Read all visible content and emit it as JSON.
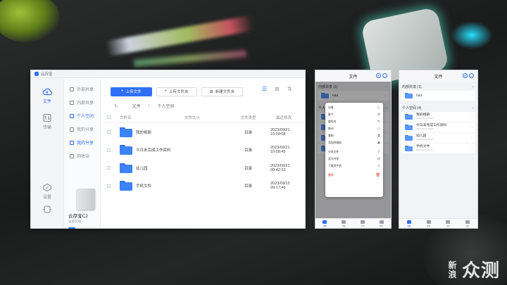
{
  "desktop": {
    "window_title": "云存宝",
    "rail": [
      {
        "label": "文件",
        "active": true,
        "icon": "cloud-icon"
      },
      {
        "label": "传输",
        "active": false,
        "icon": "transfer-icon"
      }
    ],
    "rail_bottom": [
      {
        "label": "设置",
        "icon": "settings-icon"
      },
      {
        "label": "",
        "icon": "app-icon"
      }
    ],
    "sidebar": [
      {
        "label": "外部共享",
        "active": false
      },
      {
        "label": "内部共享",
        "active": false
      },
      {
        "label": "个人空间",
        "active": true
      },
      {
        "label": "我的分享",
        "active": false
      },
      {
        "label": "我的分享",
        "active": true
      },
      {
        "label": "回收站",
        "active": false
      }
    ],
    "device": {
      "name": "云存宝C2",
      "sub": "设备在线",
      "used_fraction": 0.25
    },
    "toolbar": {
      "upload_file": "上传文件",
      "upload_folder": "上传文件夹",
      "new_folder": "新建文件夹"
    },
    "breadcrumb": {
      "root": "文件",
      "sep": ">",
      "current": "个人空间"
    },
    "columns": {
      "name": "文件名",
      "size": "文件大小",
      "type": "文件类型",
      "modified": "最近修改"
    },
    "files": [
      {
        "name": "我的相册",
        "size": "",
        "type": "目录",
        "modified": "2023/09/21 10:09:08"
      },
      {
        "name": "今日未完成工作资料",
        "size": "",
        "type": "目录",
        "modified": "2023/09/21 10:08:45"
      },
      {
        "name": "幼儿园",
        "size": "",
        "type": "目录",
        "modified": "2023/09/21 09:42:23"
      },
      {
        "name": "手机文件",
        "size": "",
        "type": "目录",
        "modified": "2023/09/15 09:17:46"
      }
    ]
  },
  "phone_menu": {
    "title": "文件",
    "section1": {
      "label": "内部共享",
      "count": "(1)"
    },
    "first_item": "hdd",
    "section2": {
      "label": "个人空间"
    },
    "menu_items": [
      {
        "label": "详情",
        "icon": "ⓘ"
      },
      {
        "label": "推介",
        "icon": "⊘"
      },
      {
        "label": "重命名",
        "icon": "✎"
      },
      {
        "label": "移动",
        "icon": "▭"
      },
      {
        "label": "复制",
        "icon": "⧉"
      },
      {
        "label": "添加到相册",
        "icon": "⛰"
      },
      {
        "label": "分享文件",
        "icon": "⇪"
      },
      {
        "label": "设为共享",
        "icon": "⇄"
      },
      {
        "label": "下载到手机",
        "icon": "⇩"
      },
      {
        "label": "删除",
        "icon": "🗑",
        "danger": true
      }
    ],
    "tabs": [
      {
        "label": "文件",
        "active": true
      },
      {
        "label": "传输"
      },
      {
        "label": "应用"
      },
      {
        "label": "我的"
      }
    ]
  },
  "phone_list": {
    "title": "文件",
    "section1": {
      "label": "内部共享",
      "count": "(1)"
    },
    "shared": [
      {
        "name": "hdd",
        "meta": ""
      }
    ],
    "section2": {
      "label": "个人空间",
      "count": "(4)"
    },
    "items": [
      {
        "name": "我的相册",
        "meta": "2023-09-21 10:09"
      },
      {
        "name": "今日未完成工作资料",
        "meta": "2023-09-21 10:08"
      },
      {
        "name": "幼儿园",
        "meta": "2023-09-21 09:42"
      },
      {
        "name": "手机文件",
        "meta": "2023-09-15 09:17"
      }
    ],
    "tabs": [
      {
        "label": "文件",
        "active": true
      },
      {
        "label": "传输"
      },
      {
        "label": "应用"
      },
      {
        "label": "我的"
      }
    ]
  },
  "watermark": {
    "small": "新浪",
    "big": "众测"
  }
}
